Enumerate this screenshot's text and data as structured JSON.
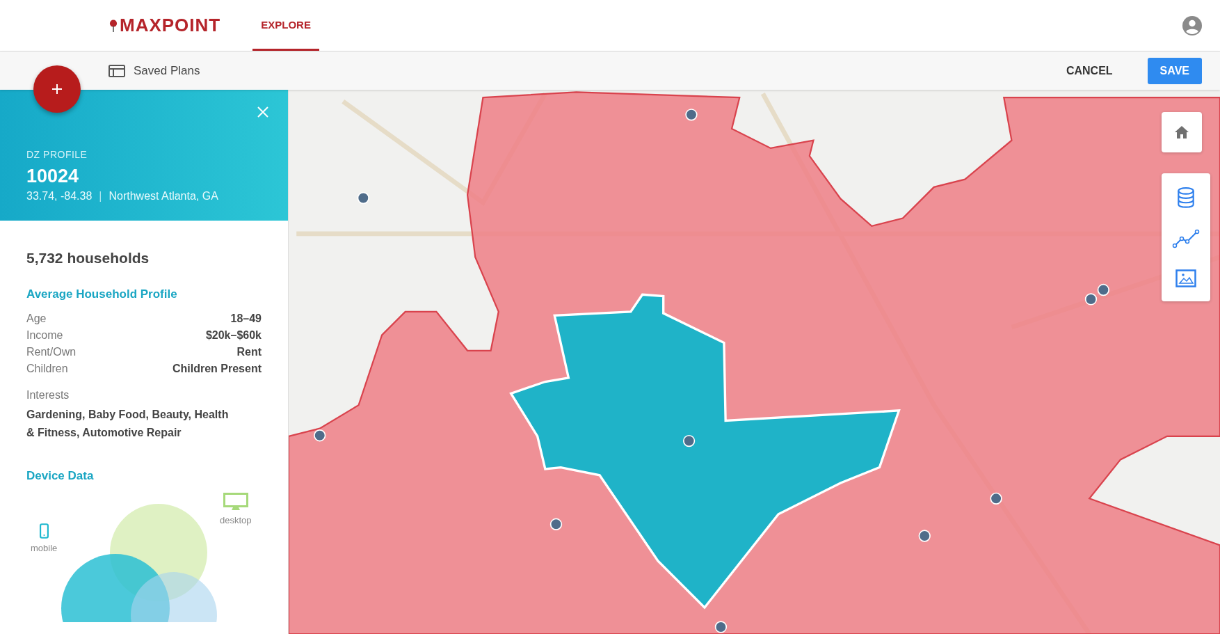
{
  "header": {
    "logo": "MAXPOINT",
    "nav": [
      {
        "label": "EXPLORE",
        "selected": true
      }
    ]
  },
  "toolbar": {
    "saved_plans": "Saved Plans",
    "cancel": "CANCEL",
    "save": "SAVE"
  },
  "profile": {
    "eyebrow": "DZ PROFILE",
    "zone": "10024",
    "coords": "33.74, -84.38",
    "separator": "|",
    "location": "Northwest Atlanta, GA"
  },
  "households": "5,732 households",
  "avg_profile": {
    "title": "Average Household Profile",
    "rows": [
      {
        "label": "Age",
        "value": "18–49"
      },
      {
        "label": "Income",
        "value": "$20k–$60k"
      },
      {
        "label": "Rent/Own",
        "value": "Rent"
      },
      {
        "label": "Children",
        "value": "Children Present"
      }
    ],
    "interests_label": "Interests",
    "interests": "Gardening, Baby Food, Beauty, Health & Fitness, Automotive Repair"
  },
  "device_data": {
    "title": "Device Data",
    "mobile": "mobile",
    "desktop": "desktop"
  }
}
